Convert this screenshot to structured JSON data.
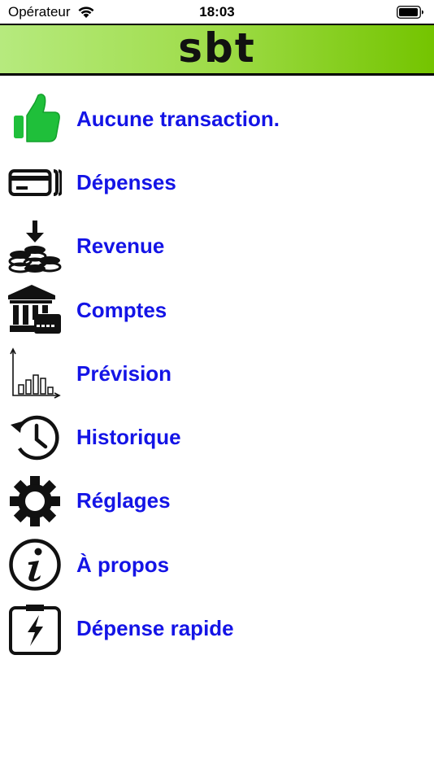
{
  "status_bar": {
    "carrier": "Opérateur",
    "time": "18:03"
  },
  "header": {
    "logo_text": "sbt",
    "gradient_colors": [
      "#b6ea7e",
      "#9edc48",
      "#74c400"
    ]
  },
  "accent_color": "#1414e6",
  "menu": {
    "items": [
      {
        "label": "Aucune transaction.",
        "icon": "thumbs-up-icon",
        "icon_color": "#1fbf3a"
      },
      {
        "label": "Dépenses",
        "icon": "credit-cards-icon"
      },
      {
        "label": "Revenue",
        "icon": "coins-download-icon"
      },
      {
        "label": "Comptes",
        "icon": "bank-card-icon"
      },
      {
        "label": "Prévision",
        "icon": "bar-chart-icon"
      },
      {
        "label": "Historique",
        "icon": "history-clock-icon"
      },
      {
        "label": "Réglages",
        "icon": "gear-icon"
      },
      {
        "label": "À propos",
        "icon": "info-icon"
      },
      {
        "label": "Dépense rapide",
        "icon": "lightning-clipboard-icon"
      }
    ]
  }
}
